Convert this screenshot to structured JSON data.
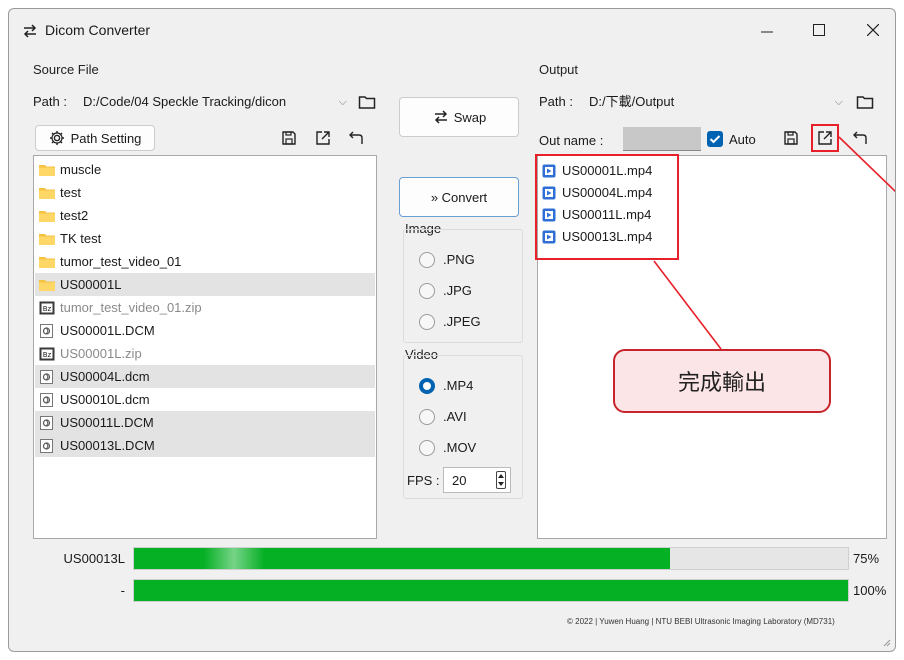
{
  "window": {
    "title": "Dicom Converter"
  },
  "source": {
    "group_label": "Source File",
    "path_label": "Path :",
    "path_value": "D:/Code/04 Speckle Tracking/dicon",
    "path_setting_label": "Path Setting",
    "files": [
      {
        "name": "muscle",
        "type": "folder",
        "selected": false,
        "dim": false
      },
      {
        "name": "test",
        "type": "folder",
        "selected": false,
        "dim": false
      },
      {
        "name": "test2",
        "type": "folder",
        "selected": false,
        "dim": false
      },
      {
        "name": "TK test",
        "type": "folder",
        "selected": false,
        "dim": false
      },
      {
        "name": "tumor_test_video_01",
        "type": "folder",
        "selected": false,
        "dim": false
      },
      {
        "name": "US00001L",
        "type": "folder",
        "selected": true,
        "dim": false
      },
      {
        "name": "tumor_test_video_01.zip",
        "type": "zip",
        "selected": false,
        "dim": true
      },
      {
        "name": "US00001L.DCM",
        "type": "dcm",
        "selected": false,
        "dim": false
      },
      {
        "name": "US00001L.zip",
        "type": "zip",
        "selected": false,
        "dim": true
      },
      {
        "name": "US00004L.dcm",
        "type": "dcm",
        "selected": true,
        "dim": false
      },
      {
        "name": "US00010L.dcm",
        "type": "dcm",
        "selected": false,
        "dim": false
      },
      {
        "name": "US00011L.DCM",
        "type": "dcm",
        "selected": true,
        "dim": false
      },
      {
        "name": "US00013L.DCM",
        "type": "dcm",
        "selected": true,
        "dim": false
      }
    ]
  },
  "middle": {
    "swap_label": "Swap",
    "convert_label": "» Convert",
    "image_label": "Image",
    "image_options": [
      ".PNG",
      ".JPG",
      ".JPEG"
    ],
    "video_label": "Video",
    "video_options": [
      ".MP4",
      ".AVI",
      ".MOV"
    ],
    "video_selected": ".MP4",
    "fps_label": "FPS :",
    "fps_value": "20"
  },
  "output": {
    "group_label": "Output",
    "path_label": "Path :",
    "path_value": "D:/下載/Output",
    "out_name_label": "Out name :",
    "auto_label": "Auto",
    "auto_checked": true,
    "files": [
      "US00001L.mp4",
      "US00004L.mp4",
      "US00011L.mp4",
      "US00013L.mp4"
    ]
  },
  "progress": {
    "rows": [
      {
        "label": "US00013L",
        "percent_label": "75%",
        "fraction": 0.75
      },
      {
        "label": "-",
        "percent_label": "100%",
        "fraction": 1.0
      }
    ]
  },
  "annotation": {
    "callout_text": "完成輸出"
  },
  "footer": {
    "text": "© 2022 | Yuwen Huang | NTU BEBI Ultrasonic Imaging Laboratory (MD731)"
  },
  "colors": {
    "accent": "#0063b1",
    "progress": "#06b025",
    "highlight": "#e8202a"
  }
}
